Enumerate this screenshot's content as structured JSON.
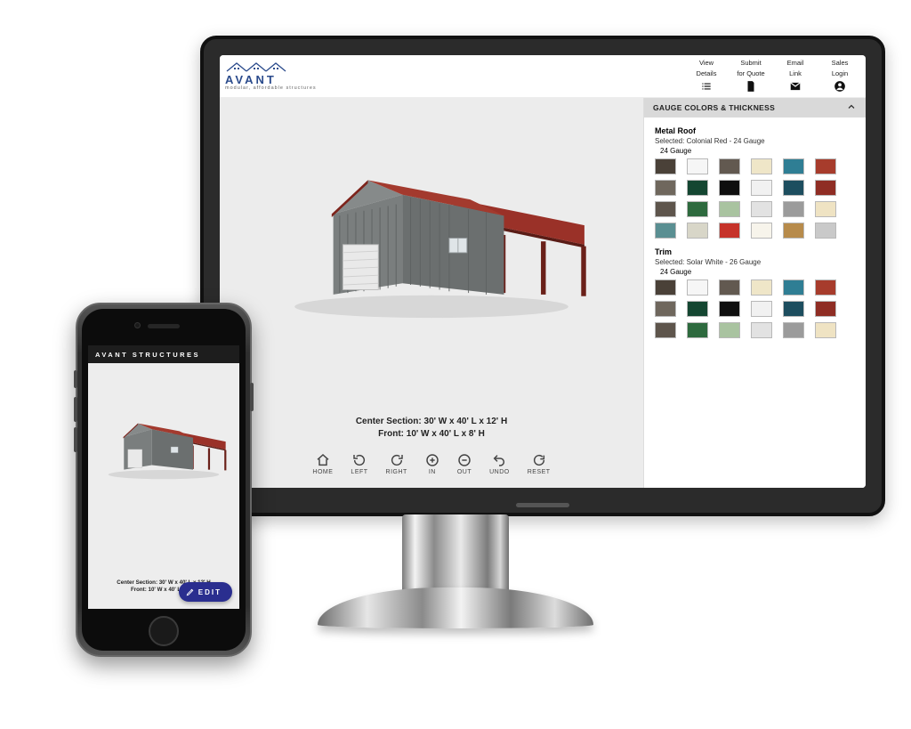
{
  "brand": {
    "name": "AVANT",
    "tagline": "modular, affordable structures"
  },
  "topbar": {
    "view_details": {
      "l1": "View",
      "l2": "Details"
    },
    "submit_quote": {
      "l1": "Submit",
      "l2": "for Quote"
    },
    "email_link": {
      "l1": "Email",
      "l2": "Link"
    },
    "sales_login": {
      "l1": "Sales",
      "l2": "Login"
    }
  },
  "viewer": {
    "dims_line1": "Center Section: 30' W x 40' L x 12' H",
    "dims_line2": "Front: 10' W x 40' L x 8' H",
    "controls": {
      "home": "HOME",
      "left": "LEFT",
      "right": "RIGHT",
      "in": "IN",
      "out": "OUT",
      "undo": "UNDO",
      "reset": "RESET"
    }
  },
  "panel": {
    "title": "GAUGE COLORS & THICKNESS",
    "roof": {
      "heading": "Metal Roof",
      "selected": "Selected: Colonial Red - 24 Gauge",
      "group": "24 Gauge",
      "swatches": [
        "#4a4138",
        "#f6f6f6",
        "#625950",
        "#efe6c8",
        "#2f7e94",
        "#a73c2c",
        "#6f675d",
        "#144631",
        "#0f0f0f",
        "#f1f1f1",
        "#1d4e5f",
        "#8f2d24",
        "#5e554c",
        "#2e6a3e",
        "#a9c3a0",
        "#e2e2e2",
        "#9b9b9b",
        "#efe3c3",
        "#5a8f92",
        "#d8d6c8",
        "#c6332a",
        "#f7f4eb",
        "#b78b4b",
        "#c9c9c9"
      ]
    },
    "trim": {
      "heading": "Trim",
      "selected": "Selected: Solar White - 26 Gauge",
      "group": "24 Gauge",
      "swatches": [
        "#4a4138",
        "#f6f6f6",
        "#625950",
        "#efe6c8",
        "#2f7e94",
        "#a73c2c",
        "#6f675d",
        "#144631",
        "#0f0f0f",
        "#f1f1f1",
        "#1d4e5f",
        "#8f2d24",
        "#5e554c",
        "#2e6a3e",
        "#a9c3a0",
        "#e2e2e2",
        "#9b9b9b",
        "#efe3c3"
      ]
    }
  },
  "phone": {
    "title": "AVANT STRUCTURES",
    "dims_line1": "Center Section: 30' W x 40' L x 12' H",
    "dims_line2": "Front: 10' W x 40' L x 8' H",
    "edit_label": "EDIT"
  }
}
